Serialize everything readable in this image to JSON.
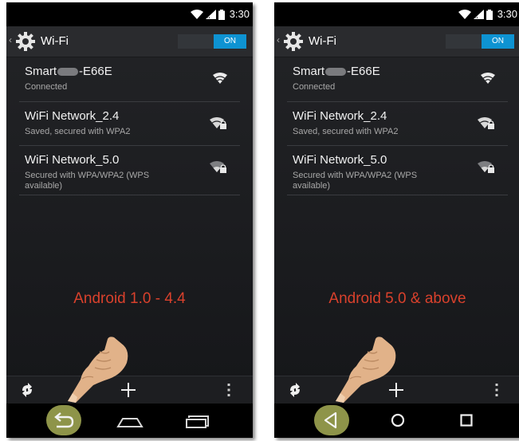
{
  "status_bar": {
    "time": "3:30"
  },
  "action_bar": {
    "title": "Wi-Fi",
    "toggle_label": "ON"
  },
  "networks": [
    {
      "name_prefix": "Smart",
      "name_suffix": "-E66E",
      "status": "Connected",
      "icon": "wifi-full-icon"
    },
    {
      "name": "WiFi Network_2.4",
      "status": "Saved, secured with WPA2",
      "icon": "wifi-locked-icon"
    },
    {
      "name": "WiFi Network_5.0",
      "status": "Secured with WPA/WPA2 (WPS available)",
      "icon": "wifi-locked-weak-icon"
    }
  ],
  "captions": {
    "left": "Android 1.0 - 4.4",
    "right": "Android 5.0 & above"
  },
  "bottom_bar_icons": [
    "refresh-icon",
    "plus-icon",
    "overflow-menu-icon"
  ],
  "nav_bar": {
    "left_icons": [
      "back-icon",
      "home-icon",
      "recents-icon"
    ],
    "right_icons": [
      "back-triangle-icon",
      "home-circle-icon",
      "recents-square-icon"
    ]
  },
  "colors": {
    "accent": "#0e93d2",
    "caption": "#d9412c",
    "highlight": "#8e9449",
    "background": "#1b1c1f"
  }
}
